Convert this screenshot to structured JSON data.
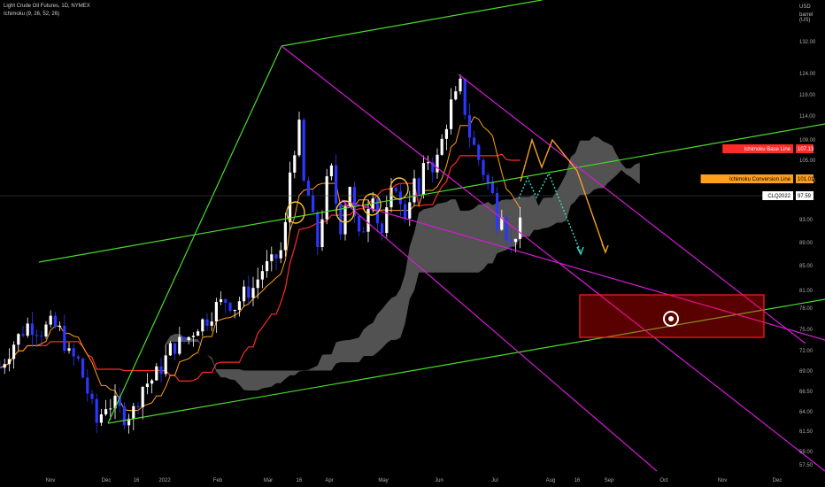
{
  "header": {
    "symbol_line": "Light Crude Oil Futures, 1D, NYMEX",
    "indicator_line": "Ichimoku (9, 26, 52, 26)"
  },
  "price_scale": {
    "currency": "USD",
    "unit": "barrel (US)"
  },
  "colors": {
    "background": "#000000",
    "bull": "#ffffff",
    "bear": "#2b36ff",
    "base_line": "#ff2a2a",
    "conversion_line": "#ff9f1a",
    "cloud": "#6e6e6e",
    "trendline": "#4bdb2a",
    "channel": "#d61bd6",
    "projection_up": "#f5a020",
    "projection_down": "#33dccc",
    "target_box": "#ff2020",
    "circles": "#f5c430"
  },
  "chart_data": {
    "type": "candlestick",
    "title": "Light Crude Oil Futures, 1D, NYMEX",
    "ylim": [
      56.5,
      136
    ],
    "y_ticks": [
      "132.00",
      "124.00",
      "119.00",
      "114.00",
      "109.00",
      "105.00",
      "101.00",
      "97.00",
      "93.00",
      "89.00",
      "85.00",
      "81.00",
      "78.00",
      "75.00",
      "72.00",
      "69.00",
      "66.50",
      "64.00",
      "61.50",
      "59.00",
      "57.50"
    ],
    "x_ticks": [
      "Nov",
      "Dec",
      "16",
      "2022",
      "Feb",
      "Mar",
      "16",
      "Apr",
      "May",
      "Jun",
      "Jul",
      "Aug",
      "16",
      "Sep",
      "Oct",
      "Nov",
      "Dec"
    ],
    "grid": false,
    "price_path": [
      [
        0,
        76
      ],
      [
        3,
        80
      ],
      [
        6,
        83
      ],
      [
        9,
        82
      ],
      [
        11,
        83
      ],
      [
        13,
        82
      ],
      [
        15,
        78
      ],
      [
        17,
        77
      ],
      [
        19,
        72
      ],
      [
        21,
        67
      ],
      [
        23,
        70
      ],
      [
        25,
        70
      ],
      [
        27,
        68
      ],
      [
        29,
        69
      ],
      [
        31,
        73
      ],
      [
        33,
        74
      ],
      [
        35,
        76
      ],
      [
        37,
        79
      ],
      [
        39,
        80
      ],
      [
        41,
        81
      ],
      [
        43,
        83
      ],
      [
        45,
        84
      ],
      [
        47,
        86
      ],
      [
        49,
        87
      ],
      [
        51,
        86
      ],
      [
        53,
        88
      ],
      [
        55,
        89
      ],
      [
        57,
        92
      ],
      [
        59,
        93
      ],
      [
        61,
        95
      ],
      [
        62,
        99
      ],
      [
        63,
        108
      ],
      [
        64,
        112
      ],
      [
        65,
        115
      ],
      [
        66,
        106
      ],
      [
        67,
        104
      ],
      [
        68,
        100
      ],
      [
        69,
        96
      ],
      [
        70,
        101
      ],
      [
        71,
        106
      ],
      [
        72,
        108
      ],
      [
        73,
        103
      ],
      [
        74,
        99
      ],
      [
        75,
        103
      ],
      [
        76,
        106
      ],
      [
        77,
        100
      ],
      [
        78,
        97
      ],
      [
        79,
        99
      ],
      [
        80,
        103
      ],
      [
        81,
        105
      ],
      [
        82,
        100
      ],
      [
        83,
        98
      ],
      [
        84,
        101
      ],
      [
        85,
        104
      ],
      [
        86,
        106
      ],
      [
        87,
        102
      ],
      [
        88,
        101
      ],
      [
        89,
        104
      ],
      [
        90,
        106
      ],
      [
        91,
        104
      ],
      [
        92,
        108
      ],
      [
        93,
        110
      ],
      [
        94,
        109
      ],
      [
        95,
        110
      ],
      [
        96,
        113
      ],
      [
        97,
        116
      ],
      [
        98,
        119
      ],
      [
        99,
        120
      ],
      [
        100,
        122
      ],
      [
        101,
        118
      ],
      [
        102,
        114
      ],
      [
        103,
        112
      ],
      [
        104,
        110
      ],
      [
        105,
        108
      ],
      [
        106,
        106
      ],
      [
        107,
        104
      ],
      [
        108,
        100
      ],
      [
        109,
        102
      ],
      [
        110,
        98
      ],
      [
        111,
        96
      ],
      [
        112,
        98
      ],
      [
        113,
        99
      ]
    ],
    "series": [
      {
        "name": "Ichimoku Base Line",
        "last_value": "107.13"
      },
      {
        "name": "Ichimoku Conversion Line",
        "last_value": "101.01"
      },
      {
        "name": "CLQ2022",
        "last_value": "97.59"
      }
    ],
    "target_zone": {
      "price_top": 80.5,
      "price_bottom": 74,
      "date_from": "Aug 16",
      "date_to": "Dec"
    }
  }
}
